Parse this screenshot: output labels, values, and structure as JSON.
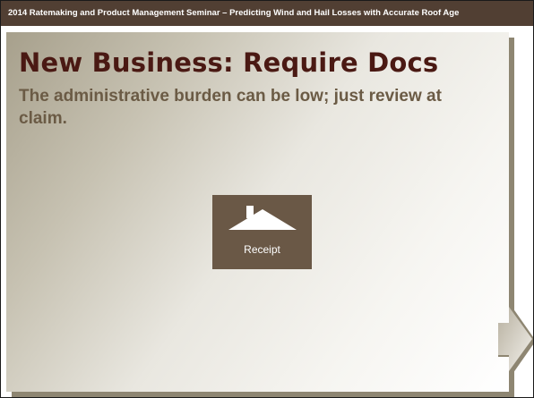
{
  "header": {
    "text": "2014 Ratemaking and Product Management Seminar – Predicting Wind and Hail Losses with Accurate Roof Age"
  },
  "slide": {
    "title": "New Business: Require Docs",
    "subtitle": "The administrative burden can be low; just review at claim."
  },
  "receipt_card": {
    "label": "Receipt",
    "icon": "house-icon"
  },
  "colors": {
    "header_bg": "#513f33",
    "title_color": "#4a1913",
    "subtitle_color": "#6b5b45",
    "card_bg": "#6a5846",
    "panel_shadow": "#8e8672"
  }
}
